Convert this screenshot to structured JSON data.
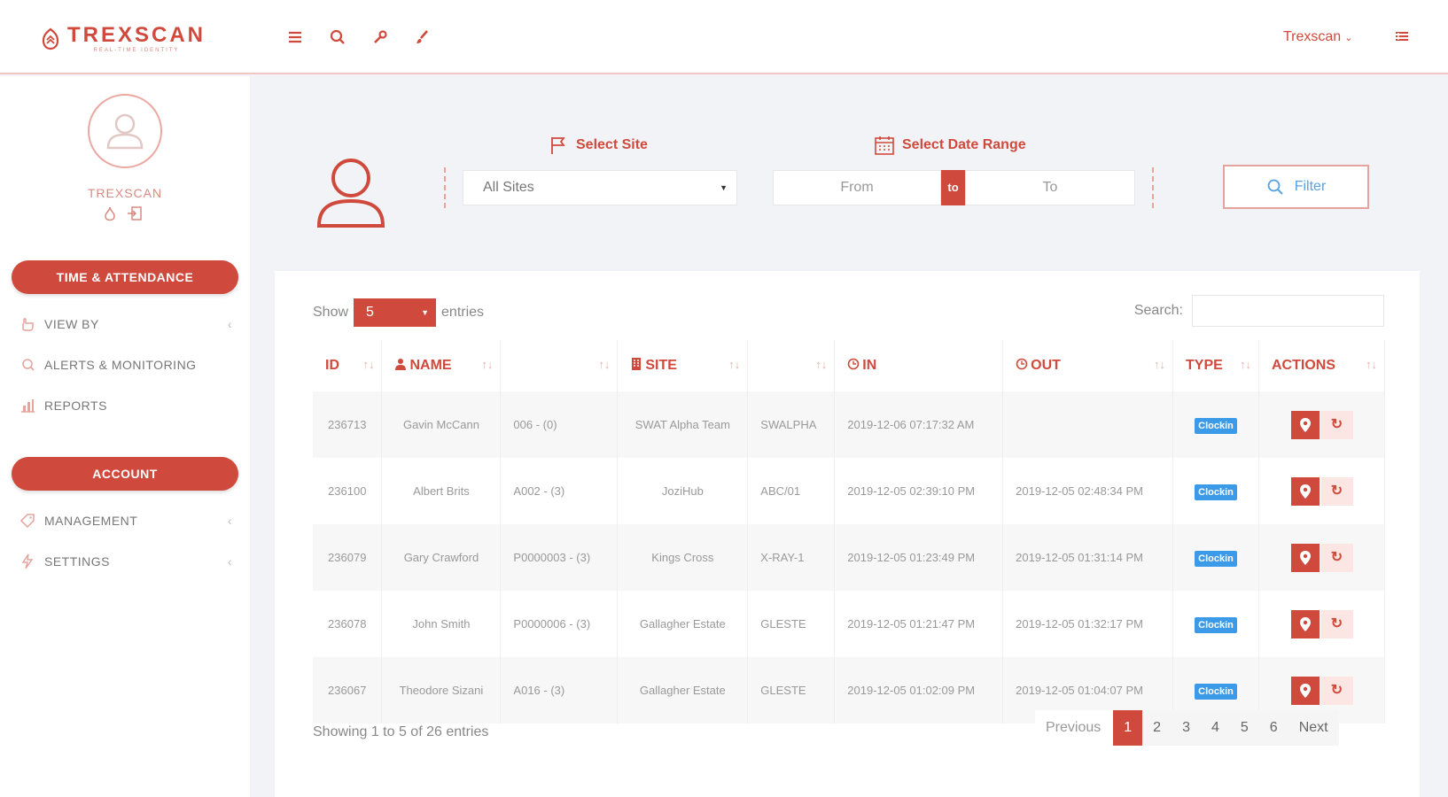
{
  "header": {
    "brand": "TREXSCAN",
    "brand_tagline": "REAL-TIME IDENTITY",
    "user_menu_label": "Trexscan",
    "icons": [
      "menu-icon",
      "search-icon",
      "wrench-icon",
      "brush-icon",
      "list-icon"
    ]
  },
  "sidebar": {
    "username": "TREXSCAN",
    "section1_label": "TIME & ATTENDANCE",
    "items1": [
      {
        "label": "VIEW BY",
        "icon": "hand-icon"
      },
      {
        "label": "ALERTS & MONITORING",
        "icon": "bell-icon"
      },
      {
        "label": "REPORTS",
        "icon": "bar-chart-icon"
      }
    ],
    "section2_label": "ACCOUNT",
    "items2": [
      {
        "label": "MANAGEMENT",
        "icon": "tag-icon"
      },
      {
        "label": "SETTINGS",
        "icon": "bolt-icon"
      }
    ]
  },
  "filters": {
    "site_label": "Select Site",
    "site_value": "All Sites",
    "date_label": "Select Date Range",
    "from_placeholder": "From",
    "to_badge": "to",
    "to_placeholder": "To",
    "filter_button": "Filter"
  },
  "table_controls": {
    "show_label": "Show",
    "entries_value": "5",
    "entries_label": "entries",
    "search_label": "Search:"
  },
  "table": {
    "headers": [
      "ID",
      "NAME",
      "",
      "SITE",
      "",
      "IN",
      "OUT",
      "TYPE",
      "ACTIONS"
    ],
    "rows": [
      {
        "id": "236713",
        "name": "Gavin McCann",
        "code": "006 - (0)",
        "site": "SWAT Alpha Team",
        "site_code": "SWALPHA",
        "in": "2019-12-06 07:17:32 AM",
        "out": "",
        "type": "Clockin"
      },
      {
        "id": "236100",
        "name": "Albert Brits",
        "code": "A002 - (3)",
        "site": "JoziHub",
        "site_code": "ABC/01",
        "in": "2019-12-05 02:39:10 PM",
        "out": "2019-12-05 02:48:34 PM",
        "type": "Clockin"
      },
      {
        "id": "236079",
        "name": "Gary Crawford",
        "code": "P0000003 - (3)",
        "site": "Kings Cross",
        "site_code": "X-RAY-1",
        "in": "2019-12-05 01:23:49 PM",
        "out": "2019-12-05 01:31:14 PM",
        "type": "Clockin"
      },
      {
        "id": "236078",
        "name": "John Smith",
        "code": "P0000006 - (3)",
        "site": "Gallagher Estate",
        "site_code": "GLESTE",
        "in": "2019-12-05 01:21:47 PM",
        "out": "2019-12-05 01:32:17 PM",
        "type": "Clockin"
      },
      {
        "id": "236067",
        "name": "Theodore Sizani",
        "code": "A016 - (3)",
        "site": "Gallagher Estate",
        "site_code": "GLESTE",
        "in": "2019-12-05 01:02:09 PM",
        "out": "2019-12-05 01:04:07 PM",
        "type": "Clockin"
      }
    ]
  },
  "footer": {
    "info": "Showing 1 to 5 of 26 entries",
    "prev": "Previous",
    "pages": [
      "1",
      "2",
      "3",
      "4",
      "5",
      "6"
    ],
    "next": "Next",
    "active_page": "1"
  },
  "colors": {
    "accent": "#cf4a3c",
    "badge_blue": "#3c9be8",
    "background": "#f1f3f6"
  }
}
